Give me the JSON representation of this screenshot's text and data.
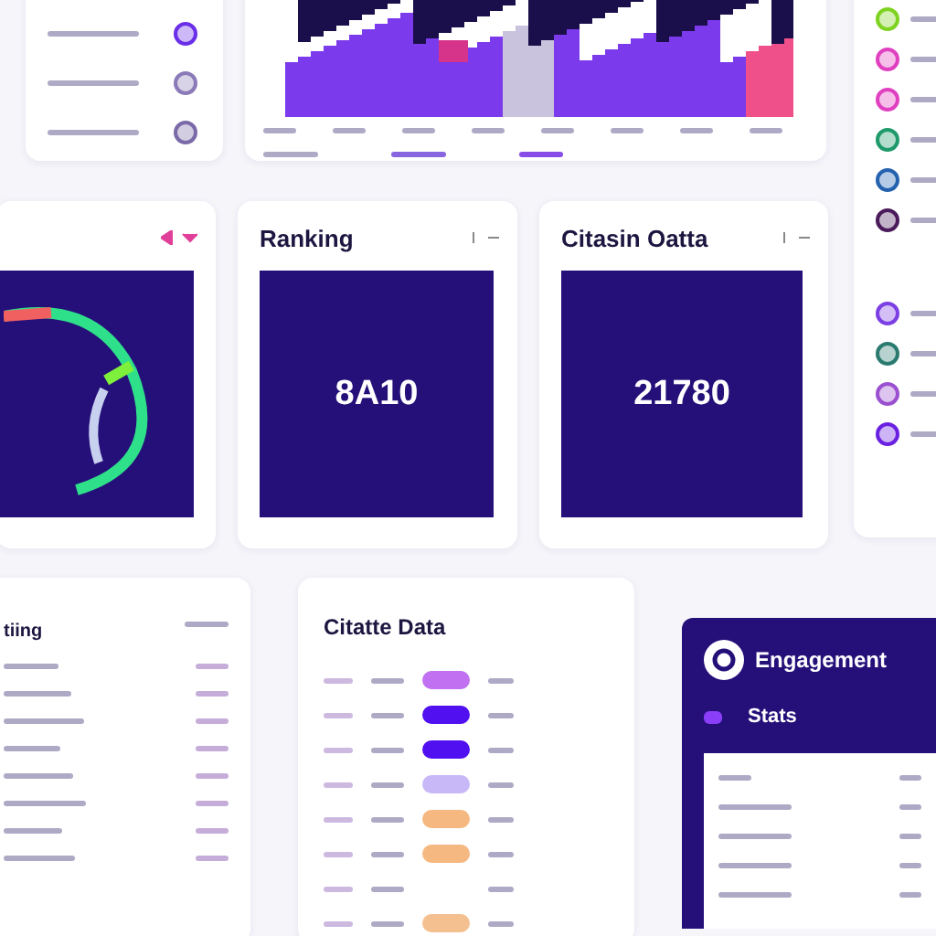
{
  "top_menu": {
    "items": [
      {
        "color": "#6a2ee8"
      },
      {
        "color": "#8a7ab8"
      },
      {
        "color": "#7a6aa8"
      }
    ]
  },
  "ranking_card": {
    "title": "Ranking",
    "value": "8A10"
  },
  "citation_card": {
    "title": "Citasin Oatta",
    "value": "21780"
  },
  "contacts": {
    "items": [
      {
        "color": "#7ed321"
      },
      {
        "color": "#e040c0"
      },
      {
        "color": "#e040c0"
      },
      {
        "color": "#1f9a6a"
      },
      {
        "color": "#2462b0"
      },
      {
        "color": "#4a1a5a"
      }
    ]
  },
  "people": {
    "items": [
      {
        "color": "#7b3fe4"
      },
      {
        "color": "#2a7a70"
      },
      {
        "color": "#9b50d0"
      },
      {
        "color": "#6a20e0"
      }
    ]
  },
  "ratings_card": {
    "title": "tiing"
  },
  "citation_data": {
    "title": "Citatte Data",
    "rows": [
      {
        "color": "#c070f0"
      },
      {
        "color": "#5010f0"
      },
      {
        "color": "#5010f0"
      },
      {
        "color": "#c8b8f8"
      },
      {
        "color": "#f5b880"
      },
      {
        "color": "#f5b880"
      },
      {},
      {
        "color": "#f5c090"
      }
    ]
  },
  "engagement": {
    "title": "Engagement",
    "tab": "Stats"
  }
}
